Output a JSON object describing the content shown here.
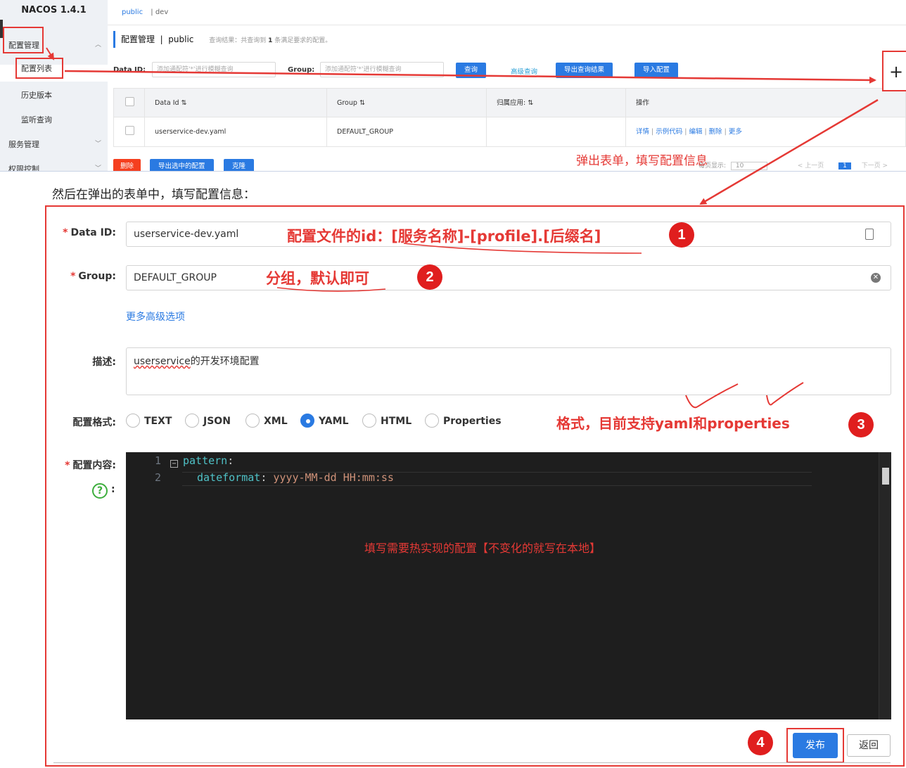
{
  "top": {
    "logo": "NACOS 1.4.1",
    "sidebar": {
      "config_mgmt": "配置管理",
      "config_list": "配置列表",
      "history": "历史版本",
      "listen": "监听查询",
      "service_mgmt": "服务管理",
      "auth": "权限控制"
    },
    "namespaces": [
      "public",
      "| dev"
    ],
    "page_title": "配置管理  |  public",
    "result_hint_prefix": "查询结果：共查询到",
    "result_hint_count": "1",
    "result_hint_suffix": "条满足要求的配置。",
    "search": {
      "data_id_label": "Data ID:",
      "data_id_placeholder": "添加通配符'*'进行模糊查询",
      "group_label": "Group:",
      "group_placeholder": "添加通配符'*'进行模糊查询",
      "query_button": "查询",
      "advanced_link": "高级查询",
      "export_button": "导出查询结果",
      "import_button": "导入配置"
    },
    "table": {
      "headers": [
        "Data Id  ⇅",
        "Group  ⇅",
        "归属应用:  ⇅",
        "操作"
      ],
      "row": {
        "data_id": "userservice-dev.yaml",
        "group": "DEFAULT_GROUP",
        "app": "",
        "ops": [
          "详情",
          "示例代码",
          "编辑",
          "删除",
          "更多"
        ]
      }
    },
    "bottom_buttons": [
      "删除",
      "导出选中的配置",
      "克隆"
    ],
    "pager": {
      "per_page_label": "每页显示:",
      "per_page_value": "10",
      "prev": "< 上一页",
      "current": "1",
      "next": "下一页 >"
    },
    "plus_icon": "+"
  },
  "annotations": {
    "popup_note": "弹出表单，填写配置信息",
    "data_id_note": "配置文件的id：[服务名称]-[profile].[后缀名]",
    "group_note": "分组，默认即可",
    "format_note": "格式，目前支持yaml和properties",
    "content_note": "填写需要热实现的配置【不变化的就写在本地】",
    "numbers": [
      "1",
      "2",
      "3",
      "4"
    ]
  },
  "description": "然后在弹出的表单中，填写配置信息：",
  "form": {
    "data_id_label": "Data ID:",
    "data_id_value": "userservice-dev.yaml",
    "group_label": "Group:",
    "group_value": "DEFAULT_GROUP",
    "more_options": "更多高级选项",
    "desc_label": "描述:",
    "desc_value_underlined": "userservice",
    "desc_value_rest": "的开发环境配置",
    "format_label": "配置格式:",
    "formats": [
      "TEXT",
      "JSON",
      "XML",
      "YAML",
      "HTML",
      "Properties"
    ],
    "selected_format": "YAML",
    "content_label": "配置内容:",
    "help_icon": "?",
    "help_colon": ":",
    "editor": {
      "line_numbers": [
        "1",
        "2"
      ],
      "line1_key": "pattern",
      "line1_punct": ":",
      "line2_key": "dateformat",
      "line2_punct": ":",
      "line2_value": "yyyy-MM-dd HH:mm:ss"
    },
    "publish_button": "发布",
    "back_button": "返回"
  }
}
